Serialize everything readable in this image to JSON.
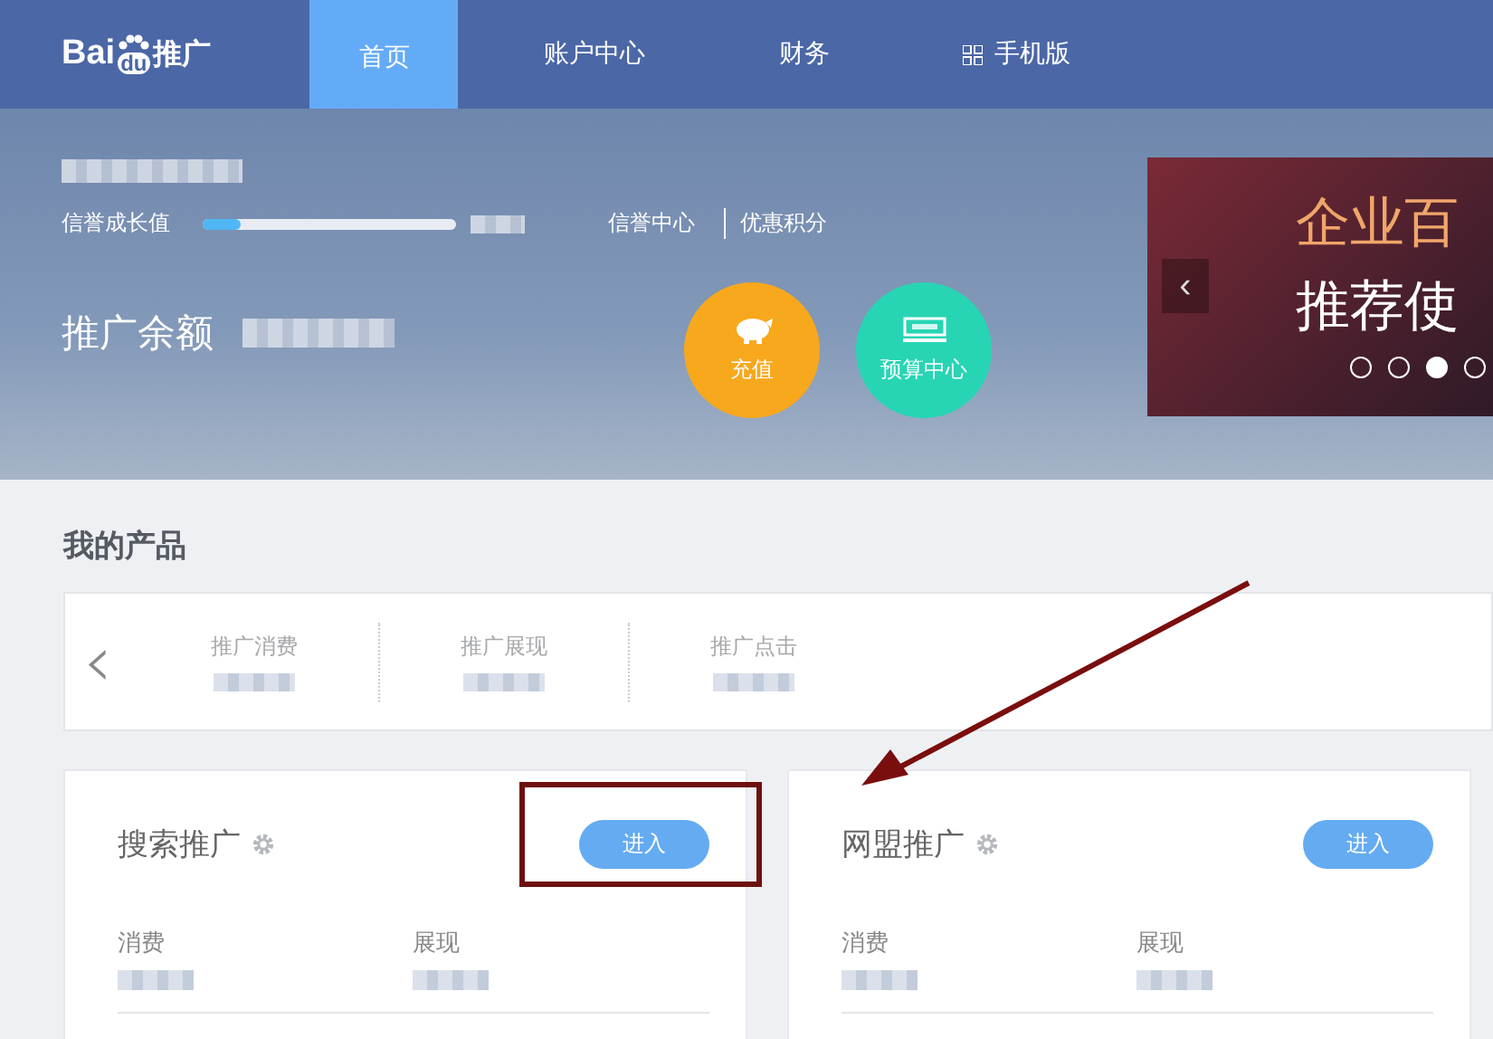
{
  "logo": {
    "brand": "Bai",
    "paw_text": "du",
    "suffix": "推广"
  },
  "nav": [
    {
      "label": "首页",
      "selected": true,
      "kind": "plain"
    },
    {
      "label": "账户中心",
      "selected": false,
      "kind": "plain"
    },
    {
      "label": "财务",
      "selected": false,
      "kind": "plain"
    },
    {
      "label": "手机版",
      "selected": false,
      "kind": "mobile"
    }
  ],
  "account": {
    "credit_label": "信誉成长值",
    "credit": {
      "level": 0.15
    },
    "links": [
      "信誉中心",
      "优惠积分"
    ],
    "balance_label": "推广余额",
    "actions": [
      {
        "label": "充值",
        "kind": "piggy",
        "color": "#f8a81c"
      },
      {
        "label": "预算中心",
        "kind": "card",
        "color": "#27d5b4"
      }
    ]
  },
  "banner": {
    "prev": "‹",
    "lines": [
      "企业百",
      "推荐使"
    ],
    "dots": [
      {
        "selected": false
      },
      {
        "selected": false
      },
      {
        "selected": true
      },
      {
        "selected": false
      }
    ]
  },
  "products": {
    "title": "我的产品",
    "prev": "‹",
    "stats": [
      "推广消费",
      "推广展现",
      "推广点击"
    ],
    "cards": [
      {
        "title": "搜索推广",
        "button": "进入",
        "highlighted": true,
        "metrics": [
          "消费",
          "展现"
        ]
      },
      {
        "title": "网盟推广",
        "button": "进入",
        "highlighted": false,
        "metrics": [
          "消费",
          "展现"
        ]
      }
    ]
  }
}
